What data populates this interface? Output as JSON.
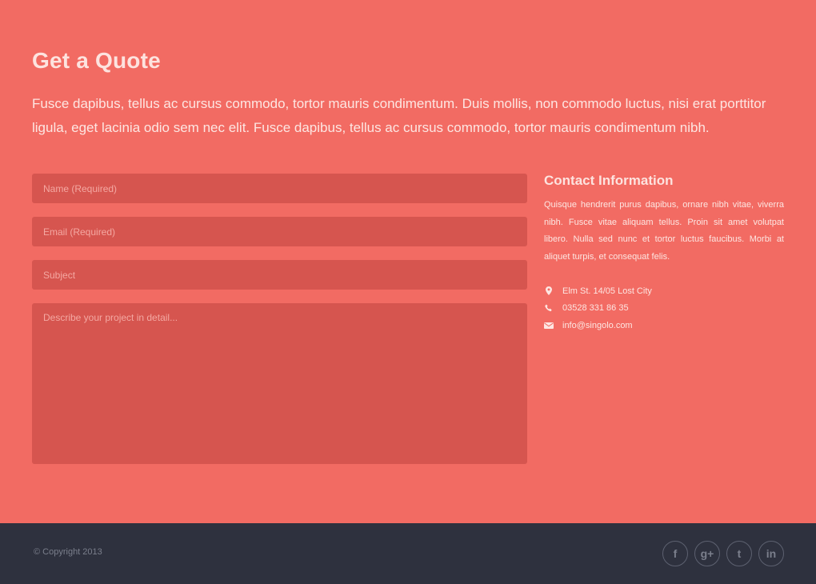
{
  "section": {
    "title": "Get a Quote",
    "intro": "Fusce dapibus, tellus ac cursus commodo, tortor mauris condimentum. Duis mollis, non commodo luctus, nisi erat porttitor ligula, eget lacinia odio sem nec elit. Fusce dapibus, tellus ac cursus commodo, tortor mauris condimentum nibh."
  },
  "form": {
    "name_placeholder": "Name (Required)",
    "email_placeholder": "Email (Required)",
    "subject_placeholder": "Subject",
    "message_placeholder": "Describe your project in detail..."
  },
  "contact": {
    "title": "Contact Information",
    "text": "Quisque hendrerit purus dapibus, ornare nibh vitae, viverra nibh. Fusce vitae aliquam tellus. Proin sit amet volutpat libero. Nulla sed nunc et tortor luctus faucibus. Morbi at aliquet turpis, et consequat felis.",
    "address": "Elm St. 14/05 Lost City",
    "phone": "03528 331 86 35",
    "email": "info@singolo.com"
  },
  "footer": {
    "copyright": "© Copyright 2013",
    "social": [
      {
        "icon": "facebook-icon",
        "glyph": "f"
      },
      {
        "icon": "google-plus-icon",
        "glyph": "g+"
      },
      {
        "icon": "twitter-icon",
        "glyph": "t"
      },
      {
        "icon": "linkedin-icon",
        "glyph": "in"
      }
    ]
  },
  "colors": {
    "background": "#f26b63",
    "field": "#d6554f",
    "footer": "#2e313e"
  }
}
